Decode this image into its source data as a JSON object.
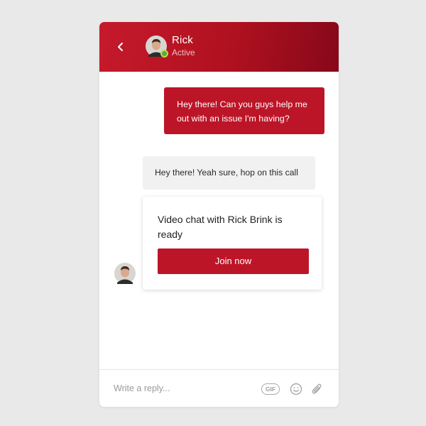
{
  "header": {
    "name": "Rick",
    "status": "Active"
  },
  "messages": [
    {
      "direction": "outgoing",
      "text": "Hey there! Can you guys help me out with an issue I'm having?"
    },
    {
      "direction": "incoming",
      "text": "Hey there! Yeah sure, hop on this call"
    }
  ],
  "video_card": {
    "text": "Video chat with Rick Brink is ready",
    "button_label": "Join now"
  },
  "composer": {
    "placeholder": "Write a reply...",
    "gif_label": "GIF"
  },
  "icons": {
    "back": "chevron-left-icon",
    "emoji": "smiley-icon",
    "attach": "paperclip-icon"
  },
  "colors": {
    "brand": "#bd1528",
    "header_dark": "#86081a",
    "incoming_bubble": "#f1f1f1",
    "online": "#4caf50"
  }
}
